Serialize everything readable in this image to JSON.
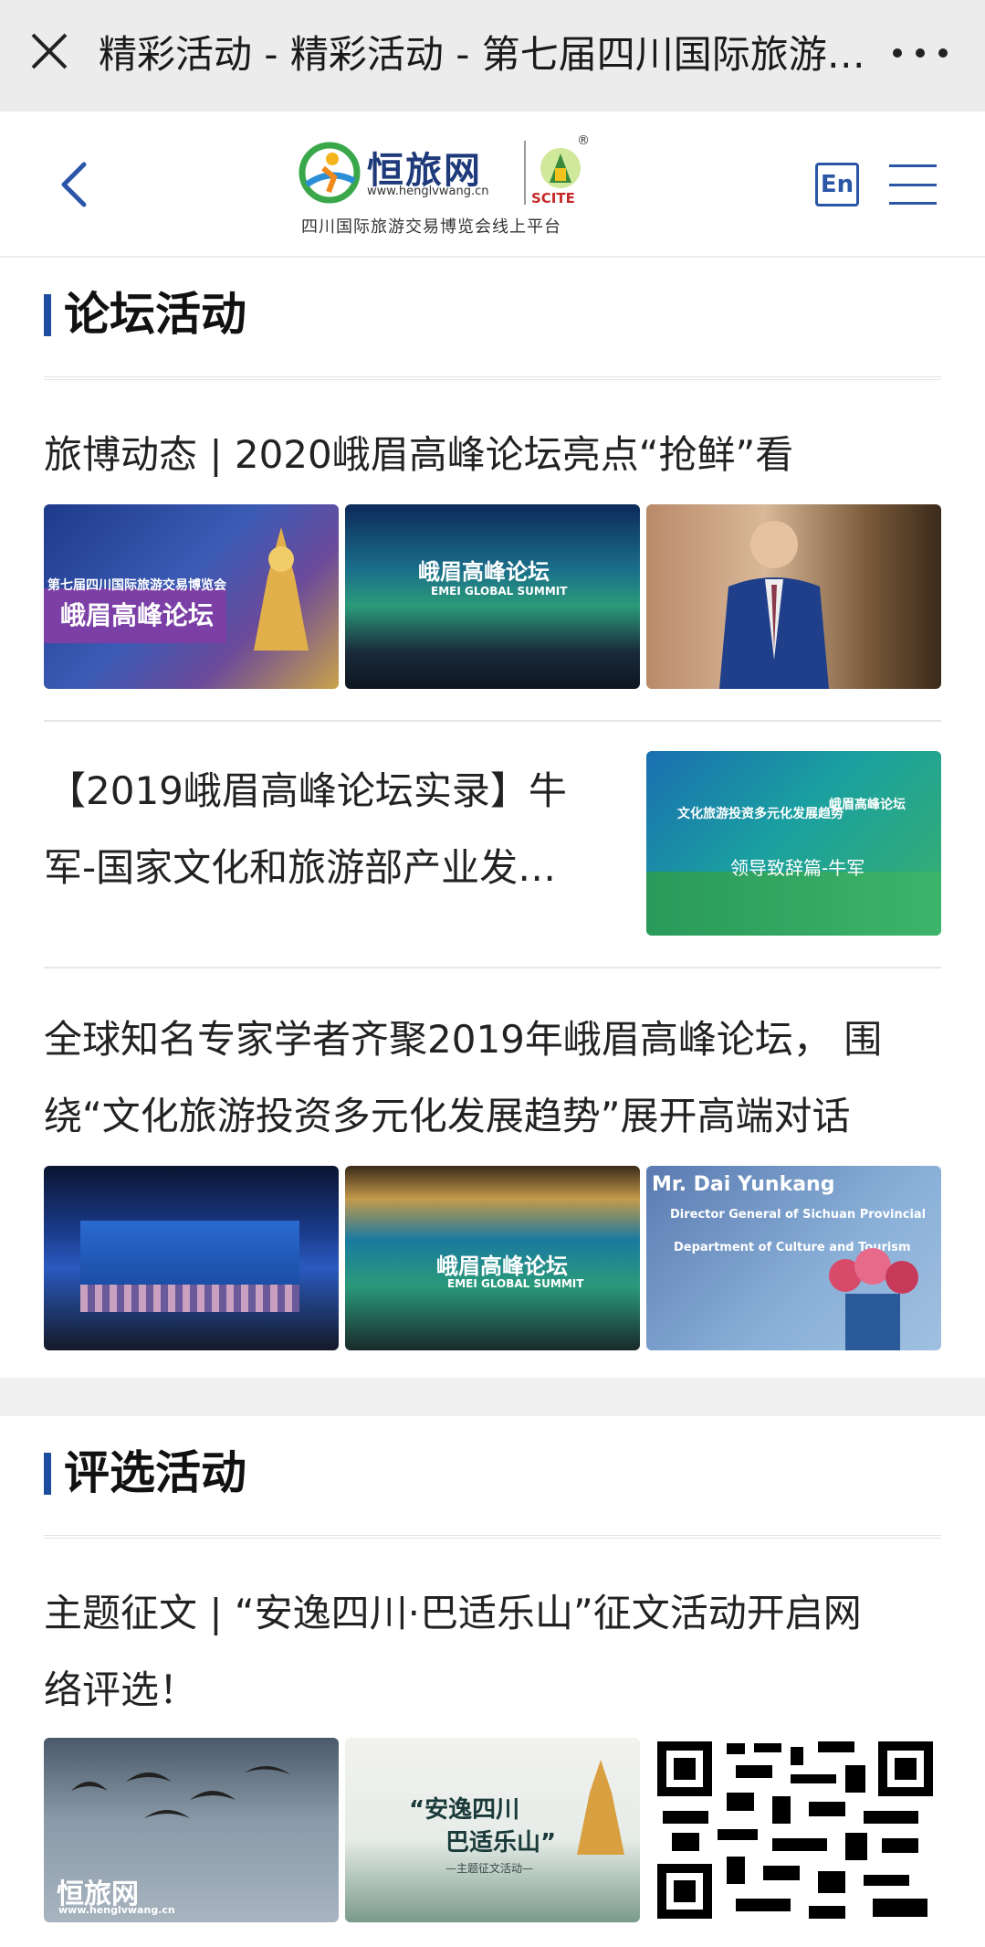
{
  "browser": {
    "title": "精彩活动 - 精彩活动 - 第七届四川国际旅游交易博览会"
  },
  "header": {
    "logo_brand": "恒旅网",
    "logo_url": "www.henglvwang.cn",
    "logo_scite": "SCITE",
    "logo_reg": "®",
    "platform": "四川国际旅游交易博览会线上平台",
    "lang_button": "En"
  },
  "forum": {
    "title": "论坛活动",
    "articles": [
      {
        "headline": "旅博动态 | 2020峨眉高峰论坛亮点“抢鲜”看",
        "images": [
          {
            "label": "峨眉高峰论坛",
            "sub": "第七届四川国际旅游交易博览会"
          },
          {
            "label": "峨眉高峰论坛",
            "sub": "EMEI GLOBAL SUMMIT"
          },
          {
            "label": ""
          }
        ]
      },
      {
        "headline_line1": "【2019峨眉高峰论坛实录】牛",
        "headline_line2": "军-国家文化和旅游部产业发…",
        "image_text_main": "领导致辞篇-牛军",
        "image_text_top": "文化旅游投资多元化发展趋势",
        "image_text_right": "峨眉高峰论坛"
      },
      {
        "headline_line1": "全球知名专家学者齐聚2019年峨眉高峰论坛，  围",
        "headline_line2": "绕“文化旅游投资多元化发展趋势”展开高端对话",
        "images": [
          {
            "label": ""
          },
          {
            "label": "峨眉高峰论坛",
            "sub": "EMEI GLOBAL SUMMIT"
          },
          {
            "label": "Mr. Dai Yunkang",
            "sub": "Director General of Sichuan Provincial",
            "sub2": "Department of Culture and Tourism"
          }
        ]
      }
    ]
  },
  "review": {
    "title": "评选活动",
    "articles": [
      {
        "headline_line1": "主题征文 | “安逸四川·巴适乐山”征文活动开启网",
        "headline_line2": "络评选！",
        "images": [
          {
            "label": "恒旅网",
            "sub": "www.henglvwang.cn"
          },
          {
            "label": "“安逸四川",
            "sub": "巴适乐山”",
            "sub2": "—主题征文活动—"
          },
          {
            "label": ""
          }
        ]
      }
    ]
  }
}
